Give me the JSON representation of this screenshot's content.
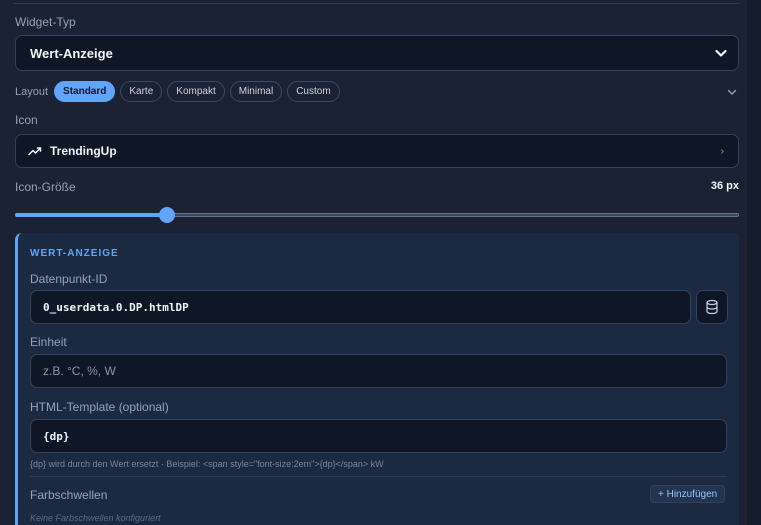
{
  "widget_type": {
    "label": "Widget-Typ",
    "value": "Wert-Anzeige"
  },
  "layout": {
    "label": "Layout",
    "options": [
      "Standard",
      "Karte",
      "Kompakt",
      "Minimal",
      "Custom"
    ],
    "selected": "Standard"
  },
  "icon": {
    "label": "Icon",
    "value": "TrendingUp",
    "icon_name": "trending-up-icon"
  },
  "icon_size": {
    "label": "Icon-Größe",
    "value_text": "36 px",
    "fraction": 0.21
  },
  "section": {
    "title": "WERT-ANZEIGE",
    "datapoint": {
      "label": "Datenpunkt-ID",
      "value": "0_userdata.0.DP.htmlDP"
    },
    "unit": {
      "label": "Einheit",
      "placeholder": "z.B. °C, %, W"
    },
    "template": {
      "label": "HTML-Template (optional)",
      "value": "{dp}",
      "hint": "{dp} wird durch den Wert ersetzt · Beispiel: <span style=\"font-size:2em\">{dp}</span> kW"
    },
    "thresholds": {
      "label": "Farbschwellen",
      "add_label": "+ Hinzufügen",
      "empty_text": "Keine Farbschwellen konfiguriert"
    }
  },
  "colors": {
    "accent": "#60a5fa",
    "background": "#1a2234",
    "input_bg": "#0f1626"
  }
}
